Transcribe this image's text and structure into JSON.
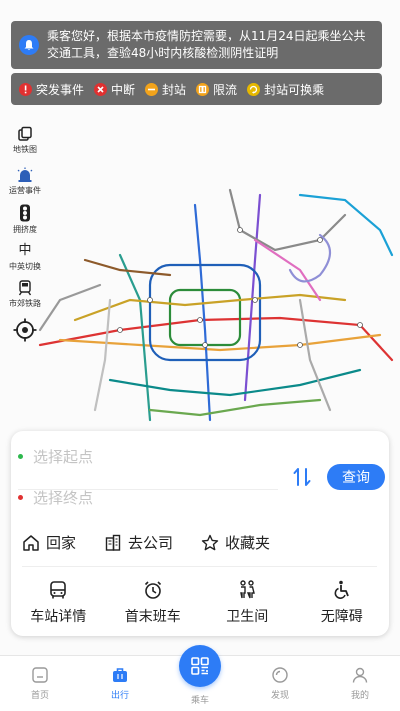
{
  "notice": {
    "text": "乘客您好，根据本市疫情防控需要，从11月24日起乘坐公共交通工具，查验48小时内核酸检测阴性证明"
  },
  "legend": [
    {
      "label": "突发事件",
      "color": "#e03131",
      "icon": "exclamation-icon"
    },
    {
      "label": "中断",
      "color": "#e03131",
      "icon": "x-icon"
    },
    {
      "label": "封站",
      "color": "#f2a31b",
      "icon": "minus-icon"
    },
    {
      "label": "限流",
      "color": "#f2a31b",
      "icon": "limit-icon"
    },
    {
      "label": "封站可换乘",
      "color": "#e6b800",
      "icon": "transfer-icon"
    }
  ],
  "tools": [
    {
      "label": "地铁图",
      "icon": "map-layers-icon"
    },
    {
      "label": "运营事件",
      "icon": "alarm-icon"
    },
    {
      "label": "拥挤度",
      "icon": "traffic-light-icon"
    },
    {
      "label": "中英切换",
      "glyph": "中",
      "icon": "language-icon"
    },
    {
      "label": "市郊铁路",
      "icon": "train-icon"
    }
  ],
  "route": {
    "start_placeholder": "选择起点",
    "end_placeholder": "选择终点",
    "start_color": "#2db84d",
    "end_color": "#e03131",
    "query_label": "查询"
  },
  "shortcuts": [
    {
      "label": "回家",
      "icon": "home-icon"
    },
    {
      "label": "去公司",
      "icon": "office-icon"
    },
    {
      "label": "收藏夹",
      "icon": "star-icon"
    }
  ],
  "features": [
    {
      "label": "车站详情",
      "icon": "bus-icon"
    },
    {
      "label": "首末班车",
      "icon": "clock-icon"
    },
    {
      "label": "卫生间",
      "icon": "restroom-icon"
    },
    {
      "label": "无障碍",
      "icon": "wheelchair-icon"
    }
  ],
  "nav": {
    "items": [
      {
        "label": "首页",
        "icon": "home-nav-icon",
        "active": false
      },
      {
        "label": "出行",
        "icon": "bag-icon",
        "active": true
      },
      {
        "label": "乘车",
        "icon": "qr-code-icon",
        "active": false
      },
      {
        "label": "发现",
        "icon": "discover-icon",
        "active": false
      },
      {
        "label": "我的",
        "icon": "user-icon",
        "active": false
      }
    ]
  },
  "colors": {
    "accent": "#2d7cf6",
    "banner_bg": "#6b6b6b"
  }
}
